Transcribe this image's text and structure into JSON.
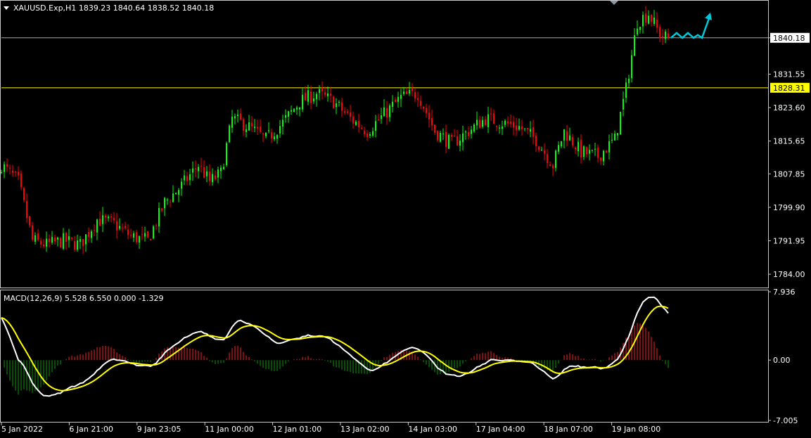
{
  "price_panel": {
    "symbol_header": "XAUUSD.Exp,H1  1839.23 1840.64 1838.52 1840.18",
    "current_price_label": "1840.18",
    "level_label": "1828.31"
  },
  "macd_panel": {
    "header": "MACD(12,26,9) 5.528 6.550 0.000 -1.329"
  },
  "chart_data": [
    {
      "type": "candlestick",
      "y_axis_ticks": [
        "1840.18",
        "1831.55",
        "1823.60",
        "1815.65",
        "1807.85",
        "1799.90",
        "1791.95",
        "1784.00"
      ],
      "ylim": [
        1781.0,
        1848.5
      ],
      "x_ticks": [
        "5 Jan 2022",
        "6 Jan 21:00",
        "9 Jan 23:05",
        "11 Jan 00:00",
        "12 Jan 01:00",
        "13 Jan 02:00",
        "14 Jan 03:00",
        "17 Jan 04:00",
        "18 Jan 07:00",
        "19 Jan 08:00"
      ],
      "horizontal_levels": [
        1840.18,
        1828.31
      ],
      "close_path": [
        {
          "i": 0,
          "v": 1810
        },
        {
          "i": 6,
          "v": 1806
        },
        {
          "i": 11,
          "v": 1792
        },
        {
          "i": 16,
          "v": 1791
        },
        {
          "i": 22,
          "v": 1792
        },
        {
          "i": 28,
          "v": 1791
        },
        {
          "i": 34,
          "v": 1797
        },
        {
          "i": 40,
          "v": 1796
        },
        {
          "i": 46,
          "v": 1793
        },
        {
          "i": 52,
          "v": 1792
        },
        {
          "i": 58,
          "v": 1801
        },
        {
          "i": 64,
          "v": 1805
        },
        {
          "i": 70,
          "v": 1810
        },
        {
          "i": 74,
          "v": 1806
        },
        {
          "i": 78,
          "v": 1808
        },
        {
          "i": 82,
          "v": 1821
        },
        {
          "i": 88,
          "v": 1819
        },
        {
          "i": 94,
          "v": 1816
        },
        {
          "i": 100,
          "v": 1820
        },
        {
          "i": 106,
          "v": 1825
        },
        {
          "i": 112,
          "v": 1827
        },
        {
          "i": 118,
          "v": 1825
        },
        {
          "i": 124,
          "v": 1821
        },
        {
          "i": 130,
          "v": 1818
        },
        {
          "i": 136,
          "v": 1822
        },
        {
          "i": 142,
          "v": 1826
        },
        {
          "i": 148,
          "v": 1827
        },
        {
          "i": 154,
          "v": 1818
        },
        {
          "i": 160,
          "v": 1815
        },
        {
          "i": 166,
          "v": 1818
        },
        {
          "i": 172,
          "v": 1821
        },
        {
          "i": 178,
          "v": 1820
        },
        {
          "i": 184,
          "v": 1819
        },
        {
          "i": 190,
          "v": 1816
        },
        {
          "i": 196,
          "v": 1810
        },
        {
          "i": 200,
          "v": 1818
        },
        {
          "i": 206,
          "v": 1813
        },
        {
          "i": 212,
          "v": 1812
        },
        {
          "i": 218,
          "v": 1816
        },
        {
          "i": 222,
          "v": 1828
        },
        {
          "i": 226,
          "v": 1844
        },
        {
          "i": 230,
          "v": 1846
        },
        {
          "i": 234,
          "v": 1841
        },
        {
          "i": 237,
          "v": 1840
        }
      ],
      "volatility": 2.2,
      "up_color": "#00ff00",
      "down_color": "#ff0000",
      "grid": false
    },
    {
      "type": "macd",
      "fast": 12,
      "slow": 26,
      "signal": 9,
      "ylim": [
        -7.005,
        7.936
      ],
      "y_axis_ticks": [
        "7.936",
        "0.00",
        "-7.005"
      ],
      "line_color": "#ffffff",
      "signal_color": "#ffff00",
      "histogram_positive_color": "#ff2020",
      "histogram_negative_color": "#00a000"
    }
  ],
  "theme": {
    "background": "#000000",
    "panel_border": "#c8c8c8",
    "level_line": "#ffff00",
    "current_price_line": "#9ea8b8",
    "projection_arrow": "#00c8d8"
  }
}
